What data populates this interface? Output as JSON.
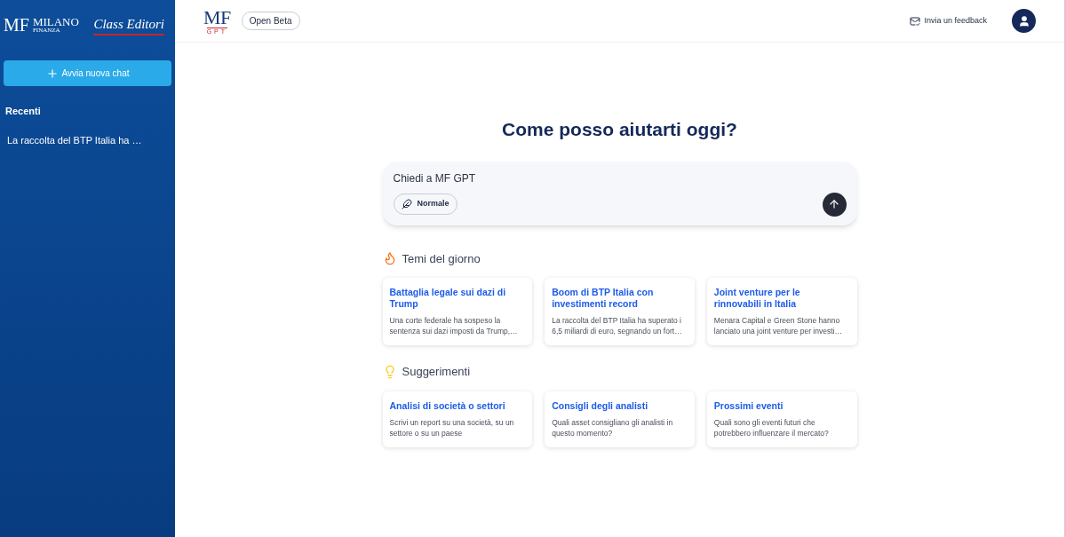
{
  "sidebar": {
    "logo": {
      "mf": "MF",
      "milano": "MILANO",
      "finanza": "FINANZA",
      "publisher": "Class Editori"
    },
    "new_chat_button": "Avvia nuova chat",
    "recent_heading": "Recenti",
    "recent_items": [
      {
        "label": "La raccolta del BTP Italia ha …",
        "selected": false
      }
    ]
  },
  "header": {
    "logo": {
      "mf": "MF",
      "gpt": "GPT"
    },
    "badge": "Open Beta",
    "feedback_link": "Invia un feedback"
  },
  "main": {
    "title": "Come posso aiutarti oggi?",
    "prompt": {
      "placeholder": "Chiedi a MF GPT",
      "mode_button": "Normale"
    },
    "sections": [
      {
        "kind": "trending",
        "heading": "Temi del giorno",
        "cards": [
          {
            "title": "Battaglia legale sui dazi di Trump",
            "text": "Una corte federale ha sospeso la sentenza sui dazi imposti da Trump,…"
          },
          {
            "title": "Boom di BTP Italia con investimenti record",
            "text": "La raccolta del BTP Italia ha superato i 6,5 miliardi di euro, segnando un fort…"
          },
          {
            "title": "Joint venture per le rinnovabili in Italia",
            "text": "Menara Capital e Green Stone hanno lanciato una joint venture per investi…"
          }
        ]
      },
      {
        "kind": "suggestions",
        "heading": "Suggerimenti",
        "cards": [
          {
            "title": "Analisi di società o settori",
            "text": "Scrivi un report su una società, su un settore o su un paese"
          },
          {
            "title": "Consigli degli analisti",
            "text": "Quali asset consigliano gli analisti in questo momento?"
          },
          {
            "title": "Prossimi eventi",
            "text": "Quali sono gli eventi futuri che potrebbero influenzare il mercato?"
          }
        ]
      }
    ]
  }
}
